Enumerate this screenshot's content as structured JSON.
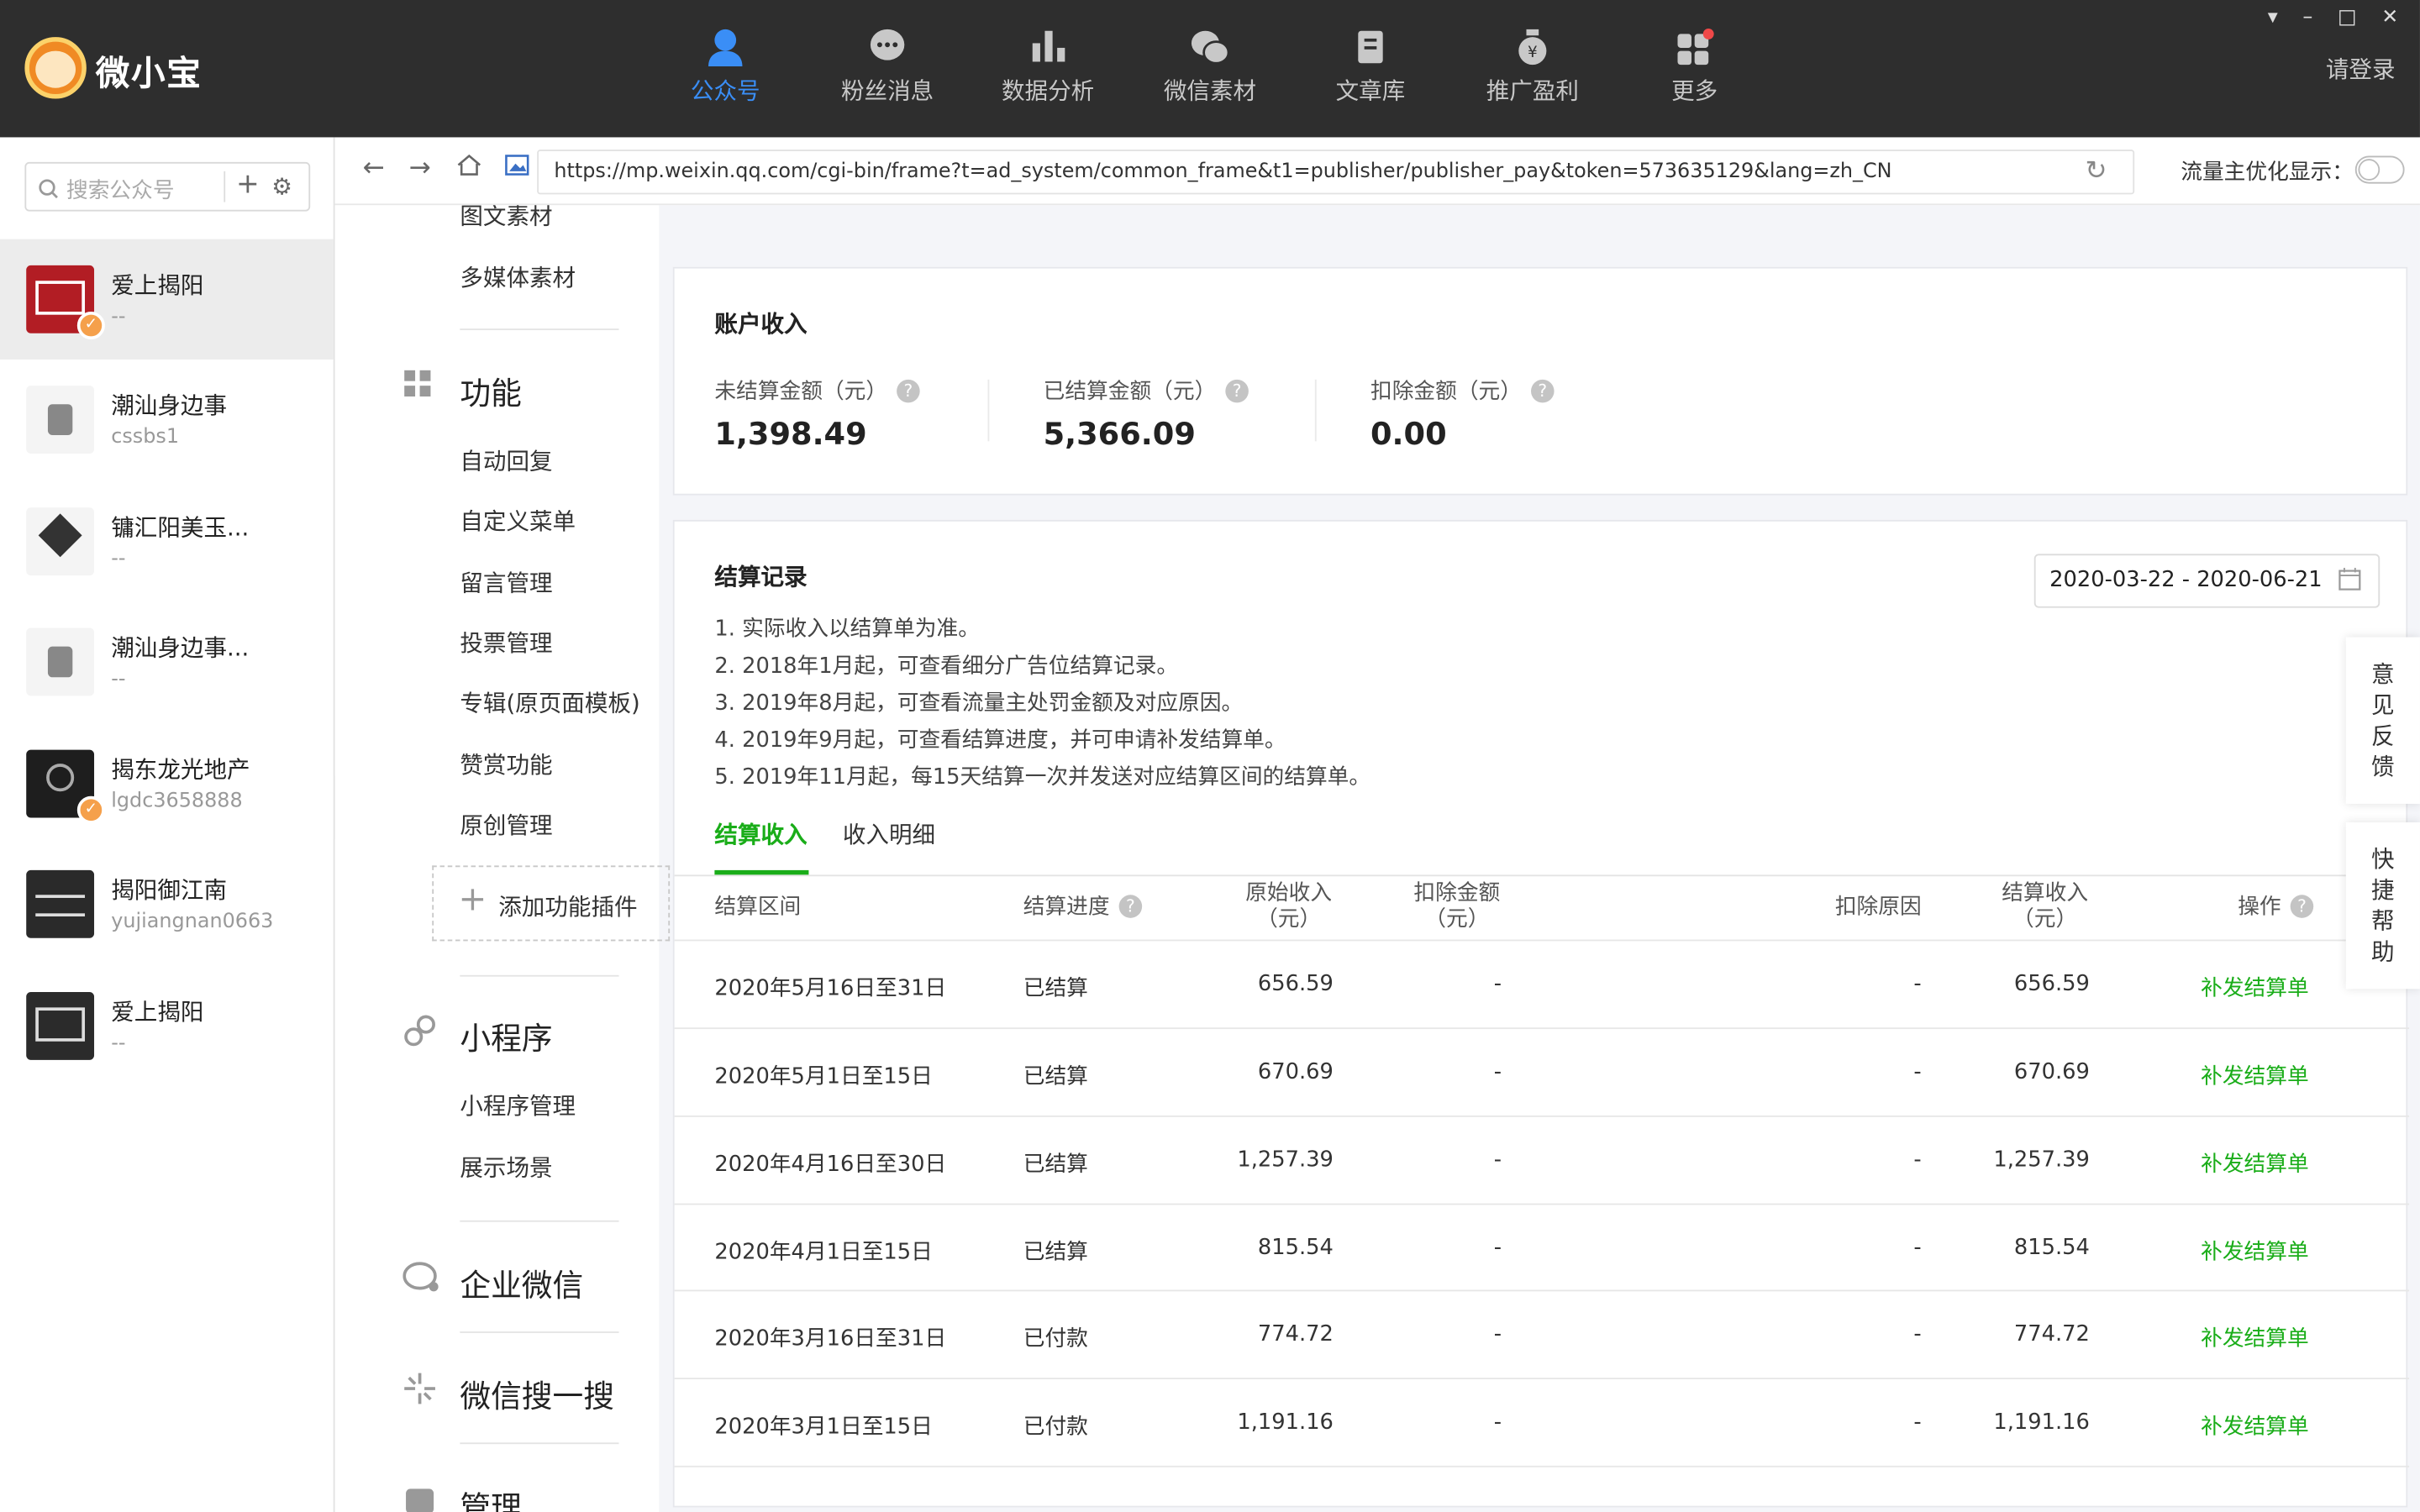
{
  "app": {
    "name": "微小宝",
    "login": "请登录"
  },
  "nav": [
    {
      "label": "公众号",
      "icon": "user-icon",
      "active": true
    },
    {
      "label": "粉丝消息",
      "icon": "chat-bubble-icon"
    },
    {
      "label": "数据分析",
      "icon": "bar-chart-icon"
    },
    {
      "label": "微信素材",
      "icon": "wechat-icon"
    },
    {
      "label": "文章库",
      "icon": "document-icon"
    },
    {
      "label": "推广盈利",
      "icon": "money-bag-icon"
    },
    {
      "label": "更多",
      "icon": "grid-icon"
    }
  ],
  "window_controls": [
    "▾",
    "–",
    "□",
    "✕"
  ],
  "sidebar": {
    "search_placeholder": "搜索公众号",
    "accounts": [
      {
        "name": "爱上揭阳",
        "sub": "--",
        "selected": true,
        "verified": true
      },
      {
        "name": "潮汕身边事",
        "sub": "cssbs1"
      },
      {
        "name": "镛汇阳美玉...",
        "sub": "--"
      },
      {
        "name": "潮汕身边事...",
        "sub": "--"
      },
      {
        "name": "揭东龙光地产",
        "sub": "lgdc3658888",
        "verified": true
      },
      {
        "name": "揭阳御江南",
        "sub": "yujiangnan0663"
      },
      {
        "name": "爱上揭阳",
        "sub": "--"
      }
    ]
  },
  "addressbar": {
    "url": "https://mp.weixin.qq.com/cgi-bin/frame?t=ad_system/common_frame&t1=publisher/publisher_pay&token=573635129&lang=zh_CN",
    "flow_label": "流量主优化显示：",
    "toggle_on": false
  },
  "menu": {
    "top_items": [
      "图文素材",
      "多媒体素材"
    ],
    "function_header": "功能",
    "function_items": [
      "自动回复",
      "自定义菜单",
      "留言管理",
      "投票管理",
      "专辑(原页面模板)",
      "赞赏功能",
      "原创管理"
    ],
    "add_plugin": "添加功能插件",
    "miniprogram_header": "小程序",
    "miniprogram_items": [
      "小程序管理",
      "展示场景"
    ],
    "enterprise_header": "企业微信",
    "search_header": "微信搜一搜",
    "manage_header": "管理"
  },
  "income": {
    "title": "账户收入",
    "stats": [
      {
        "label": "未结算金额（元）",
        "value": "1,398.49"
      },
      {
        "label": "已结算金额（元）",
        "value": "5,366.09"
      },
      {
        "label": "扣除金额（元）",
        "value": "0.00"
      }
    ]
  },
  "settlement": {
    "title": "结算记录",
    "date_range": "2020-03-22 - 2020-06-21",
    "notes": [
      "1. 实际收入以结算单为准。",
      "2. 2018年1月起，可查看细分广告位结算记录。",
      "3. 2019年8月起，可查看流量主处罚金额及对应原因。",
      "4. 2019年9月起，可查看结算进度，并可申请补发结算单。",
      "5. 2019年11月起，每15天结算一次并发送对应结算区间的结算单。"
    ],
    "tabs": [
      "结算收入",
      "收入明细"
    ],
    "columns": {
      "period": "结算区间",
      "progress": "结算进度",
      "original_1": "原始收入",
      "original_2": "（元）",
      "deduct_1": "扣除金额",
      "deduct_2": "（元）",
      "reason": "扣除原因",
      "settled_1": "结算收入",
      "settled_2": "（元）",
      "action": "操作"
    },
    "rows": [
      {
        "period": "2020年5月16日至31日",
        "progress": "已结算",
        "original": "656.59",
        "deduct": "-",
        "reason": "-",
        "settled": "656.59",
        "action": "补发结算单"
      },
      {
        "period": "2020年5月1日至15日",
        "progress": "已结算",
        "original": "670.69",
        "deduct": "-",
        "reason": "-",
        "settled": "670.69",
        "action": "补发结算单"
      },
      {
        "period": "2020年4月16日至30日",
        "progress": "已结算",
        "original": "1,257.39",
        "deduct": "-",
        "reason": "-",
        "settled": "1,257.39",
        "action": "补发结算单"
      },
      {
        "period": "2020年4月1日至15日",
        "progress": "已结算",
        "original": "815.54",
        "deduct": "-",
        "reason": "-",
        "settled": "815.54",
        "action": "补发结算单"
      },
      {
        "period": "2020年3月16日至31日",
        "progress": "已付款",
        "original": "774.72",
        "deduct": "-",
        "reason": "-",
        "settled": "774.72",
        "action": "补发结算单"
      },
      {
        "period": "2020年3月1日至15日",
        "progress": "已付款",
        "original": "1,191.16",
        "deduct": "-",
        "reason": "-",
        "settled": "1,191.16",
        "action": "补发结算单"
      }
    ]
  },
  "side_buttons": {
    "feedback": "意见反馈",
    "quick_help": "快捷帮助"
  },
  "colors": {
    "accent_green": "#1aad19",
    "nav_active": "#3a8ef6",
    "topbar": "#2e2e2e"
  }
}
